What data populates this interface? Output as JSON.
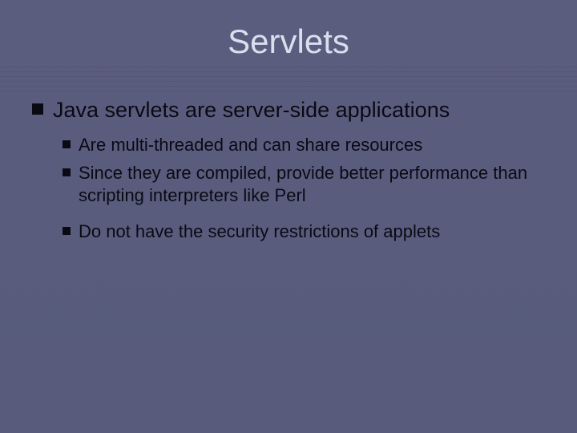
{
  "slide": {
    "title": "Servlets",
    "main_bullet": "Java servlets are server-side applications",
    "sub_bullets": [
      "Are multi-threaded and can share resources",
      "Since they are compiled, provide better performance than scripting interpreters like Perl",
      "Do not have the security restrictions of applets"
    ]
  }
}
